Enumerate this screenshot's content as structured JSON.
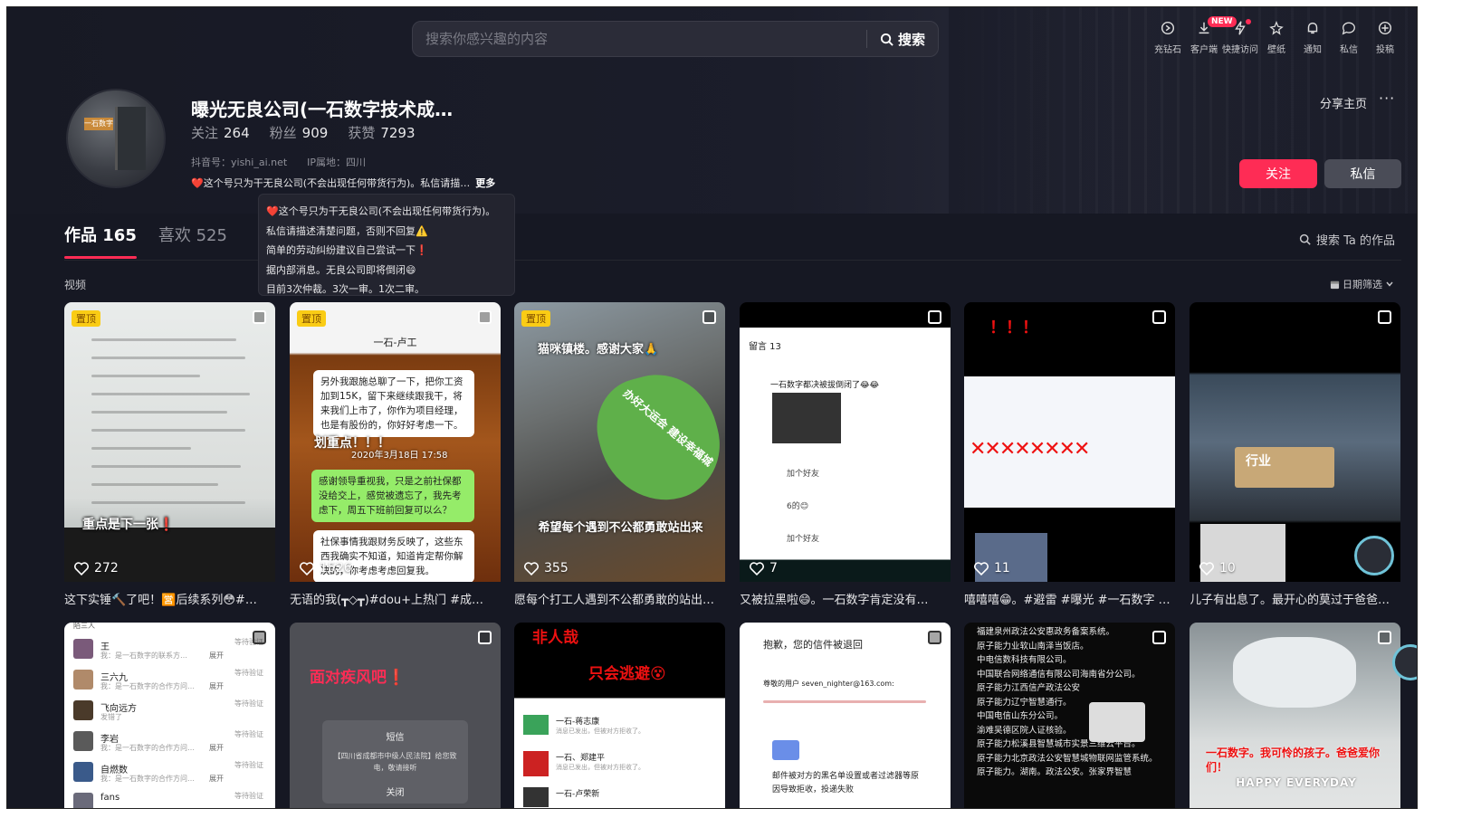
{
  "search": {
    "placeholder": "搜索你感兴趣的内容",
    "button": "搜索"
  },
  "topnav": [
    {
      "label": "充钻石",
      "icon": "diamond-icon"
    },
    {
      "label": "客户端",
      "icon": "download-icon",
      "badge": "NEW"
    },
    {
      "label": "快捷访问",
      "icon": "lightning-icon",
      "dot": true
    },
    {
      "label": "壁纸",
      "icon": "wallpaper-icon"
    },
    {
      "label": "通知",
      "icon": "bell-icon"
    },
    {
      "label": "私信",
      "icon": "message-icon"
    },
    {
      "label": "投稿",
      "icon": "upload-icon"
    }
  ],
  "profile": {
    "name": "曝光无良公司(一石数字技术成…",
    "stats": [
      {
        "k": "关注",
        "v": "264"
      },
      {
        "k": "粉丝",
        "v": "909"
      },
      {
        "k": "获赞",
        "v": "7293"
      }
    ],
    "douyin_id": "抖音号：yishi_ai.net",
    "ip": "IP属地：四川",
    "signature": "❤️这个号只为干无良公司(不会出现任何带货行为)。私信请描…",
    "more": "更多",
    "share": "分享主页",
    "follow": "关注",
    "message": "私信",
    "avatar_sign": "一石数字"
  },
  "tooltip": [
    "❤️这个号只为干无良公司(不会出现任何带货行为)。",
    "私信请描述清楚问题，否则不回复⚠️",
    "简单的劳动纠纷建议自己尝试一下❗",
    "据内部消息。无良公司即将倒闭😄",
    "目前3次仲裁。3次一审。1次二审。"
  ],
  "tabs": [
    {
      "label": "作品 165",
      "active": true
    },
    {
      "label": "喜欢 525",
      "active": false
    }
  ],
  "tab_search": "搜索 Ta 的作品",
  "section_label": "视频",
  "date_filter": "日期筛选",
  "colors": {
    "accent": "#fe2c55",
    "bg": "#161823",
    "pin": "#facc15"
  },
  "cards_row1": [
    {
      "pinned": "置顶",
      "likes": "272",
      "caption": "这下实锤🔨了吧！🈺后续系列😳#…",
      "overlay": "重点是下一张❗"
    },
    {
      "pinned": "置顶",
      "likes": "1526",
      "caption": "无语的我(┳◇┳)#dou+上热门 #成…",
      "header": "一石-卢工",
      "bubble1": "另外我跟施总聊了一下，把你工资加到15K，留下来继续跟我干，将来我们上市了，你作为项目经理，也是有股份的，你好好考虑一下。",
      "focus": "划重点！！！",
      "date": "2020年3月18日 17:58",
      "bubble2": "感谢领导重视我，只是之前社保都没给交上，感觉被遗忘了，我先考虑下，周五下班前回复可以么？",
      "bubble3": "社保事情我跟财务反映了，这些东西我确实不知道，知道肯定帮你解决的，你考虑考虑回复我。"
    },
    {
      "pinned": "置顶",
      "likes": "355",
      "caption": "愿每个打工人遇到不公都勇敢的站出…",
      "top": "猫咪镇楼。感谢大家🙏",
      "fan": "办好大运会 建设幸福城",
      "bottom": "希望每个遇到不公都勇敢站出来"
    },
    {
      "likes": "7",
      "caption": "又被拉黑啦😄。一石数字肯定没有…",
      "title": "留言 13",
      "c1": "一石数字都决被拔倒闭了😂😂",
      "c2": "加个好友",
      "c3": "6的😊",
      "c4": "加个好友"
    },
    {
      "likes": "11",
      "caption": "嘻嘻嘻😁。#避雷 #曝光 #一石数字 …",
      "top": "！！！"
    },
    {
      "likes": "10",
      "caption": "儿子有出息了。最开心的莫过于爸爸…",
      "sign": "行业"
    }
  ],
  "cards_row2": [
    {
      "rows": [
        {
          "name": "王",
          "sub": "我：是一石数字的联系方…",
          "act": "展开",
          "act2": "等待验证"
        },
        {
          "name": "三六九",
          "sub": "我：是一石数字的合作方问…",
          "act": "展开",
          "act2": "等待验证"
        },
        {
          "name": "飞向远方",
          "sub": "发错了",
          "act": "",
          "act2": "等待验证"
        },
        {
          "name": "李岩",
          "sub": "我：是一石数字的合作方问…",
          "act": "展开",
          "act2": "等待验证"
        },
        {
          "name": "自燃数",
          "sub": "我：是一石数字的合作方问…",
          "act": "展开",
          "act2": "等待验证"
        },
        {
          "name": "fans",
          "sub": "",
          "act": "",
          "act2": "等待验证"
        }
      ],
      "head": "陌三人"
    },
    {
      "title": "面对疾风吧❗",
      "dialog_title": "短信",
      "dialog_body": "【四川省成都市中级人民法院】给您致电，敬请接听",
      "dialog_close": "关闭"
    },
    {
      "title1": "非人哉",
      "title2": "只会逃避😵",
      "list": [
        "一石-蒋志康",
        "一石、郑建平",
        "一石-卢荣新"
      ],
      "sub": "消息已发出，但被对方拒收了。"
    },
    {
      "title": "抱歉，您的信件被退回",
      "greet": "尊敬的用户 seven_nighter@163.com:",
      "body": "邮件被对方的黑名单设置或者过滤器等原因导致拒收，投递失败"
    },
    {
      "lines": [
        "福建泉州政法公安惠政务备案系统。",
        "原子能力业软山南泽当饭店。",
        "中电信数科技有限公司。",
        "中国联合网络通信有限公司海南省分公司。",
        "原子能力江西信产政法公安",
        "原子能力辽宁智慧通行。",
        "中国电信山东分公司。",
        "渝难吴德区院人证核验。",
        "原子能力松溪县智慧城市实景三维云平台。",
        "原子能力北京政法公安智慧城物联网监管系统。",
        "原子能力。湖南。政法公安。张家界智慧"
      ]
    },
    {
      "slogan1": "一石数字。我可怜的孩子。爸爸爱你们！",
      "slogan2": "HAPPY EVERYDAY"
    }
  ]
}
